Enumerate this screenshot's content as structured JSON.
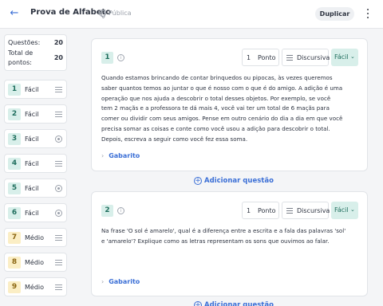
{
  "header": {
    "title": "Prova de Alfabeto",
    "visibility": "Pública",
    "duplicate_label": "Duplicar"
  },
  "summary": {
    "questions_label": "Questões:",
    "questions_value": "20",
    "points_label_line1": "Total de",
    "points_label_line2": "pontos:",
    "points_value": "20"
  },
  "sidebar": {
    "items": [
      {
        "num": "1",
        "level": "Fácil",
        "kind": "lines"
      },
      {
        "num": "2",
        "level": "Fácil",
        "kind": "lines"
      },
      {
        "num": "3",
        "level": "Fácil",
        "kind": "radio"
      },
      {
        "num": "4",
        "level": "Fácil",
        "kind": "lines"
      },
      {
        "num": "5",
        "level": "Fácil",
        "kind": "radio"
      },
      {
        "num": "6",
        "level": "Fácil",
        "kind": "radio"
      },
      {
        "num": "7",
        "level": "Médio",
        "kind": "lines"
      },
      {
        "num": "8",
        "level": "Médio",
        "kind": "lines"
      },
      {
        "num": "9",
        "level": "Médio",
        "kind": "lines"
      }
    ]
  },
  "questions": [
    {
      "num": "1",
      "points": "1",
      "points_unit": "Ponto",
      "type": "Discursiva",
      "difficulty": "Fácil",
      "lines": [
        "Quando estamos brincando de contar brinquedos ou pipocas, às vezes queremos",
        "saber quantos temos ao juntar o que é nosso com o que é do amigo. A adição é uma",
        "operação que nos ajuda a descobrir o total desses objetos. Por exemplo, se você",
        "tem 2 maçãs e a professora te dá mais 4, você vai ter um total de 6 maçãs para",
        "comer ou dividir com seus amigos. Pense em outro cenário do dia a dia em que você",
        "precisa somar as coisas e conte como você usou a adição para descobrir o total.",
        "Depois, escreva a seguir como você fez essa soma."
      ],
      "answer_label": "Gabarito"
    },
    {
      "num": "2",
      "points": "1",
      "points_unit": "Ponto",
      "type": "Discursiva",
      "difficulty": "Fácil",
      "lines": [
        "Na frase 'O sol é amarelo', qual é a diferença entre a escrita e a fala das palavras 'sol'",
        "e 'amarelo'? Explique como as letras representam os sons que ouvimos ao falar."
      ],
      "answer_label": "Gabarito"
    }
  ],
  "add_question_label": "Adicionar questão",
  "icons": {
    "back": "arrow-left-icon",
    "globe": "globe-icon",
    "kebab": "more-vertical-icon",
    "info": "info-icon",
    "lines": "text-lines-icon",
    "radio": "radio-icon",
    "chevron": "chevron-right-icon",
    "plus": "plus-circle-icon"
  },
  "colors": {
    "accent": "#3b6fd6",
    "easy_bg": "#d8efea",
    "medium_bg": "#fbeec5"
  }
}
